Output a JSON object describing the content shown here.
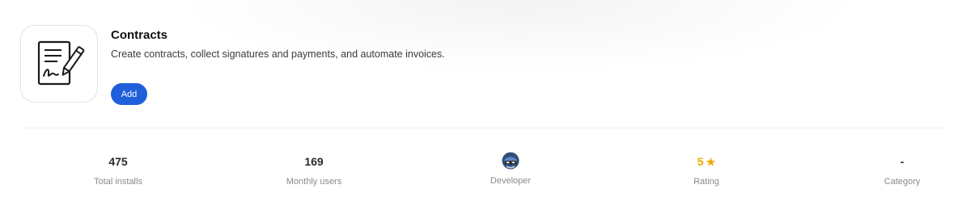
{
  "app": {
    "title": "Contracts",
    "description": "Create contracts, collect signatures and payments, and automate invoices.",
    "add_label": "Add",
    "icon": "contract-document-pen-icon"
  },
  "stats": {
    "installs": {
      "value": "475",
      "label": "Total installs"
    },
    "monthly_users": {
      "value": "169",
      "label": "Monthly users"
    },
    "developer": {
      "label": "Developer",
      "icon": "developer-avatar-icon"
    },
    "rating": {
      "value": "5",
      "label": "Rating",
      "icon": "star-icon",
      "rating_fraction": 1.0
    },
    "category": {
      "value": "-",
      "label": "Category"
    }
  },
  "colors": {
    "accent": "#1f5fd9",
    "rating": "#f2a900"
  }
}
